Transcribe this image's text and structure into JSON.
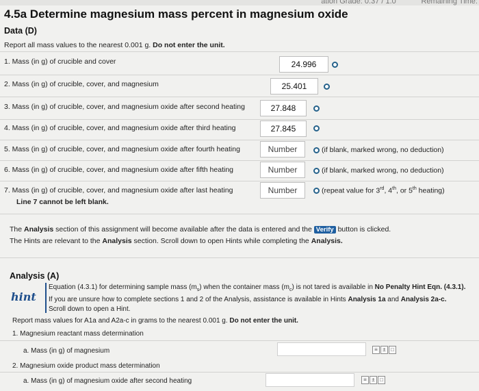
{
  "timer": {
    "label": "Remaining Time:",
    "prefix": "ation Grade: 0.37 / 1.0"
  },
  "title": "4.5a Determine magnesium mass percent in magnesium oxide",
  "data_section": {
    "heading": "Data (D)",
    "instruction_prefix": "Report all mass values to the nearest 0.001 g.",
    "instruction_bold": "Do not enter the unit.",
    "rows": [
      {
        "label": "1. Mass (in g) of crucible and cover",
        "value": "24.996"
      },
      {
        "label": "2. Mass (in g) of crucible, cover, and magnesium",
        "value": "25.401"
      },
      {
        "label": "3. Mass (in g) of crucible, cover, and magnesium oxide after second heating",
        "value": "27.848"
      },
      {
        "label": "4. Mass (in g) of crucible, cover, and magnesium oxide after third heating",
        "value": "27.845"
      },
      {
        "label": "5. Mass (in g) of crucible, cover, and magnesium oxide after fourth heating",
        "placeholder": "Number",
        "note": "(if blank, marked wrong, no deduction)"
      },
      {
        "label": "6. Mass (in g) of crucible, cover, and magnesium oxide after fifth heating",
        "placeholder": "Number",
        "note": "(if blank, marked wrong, no deduction)"
      },
      {
        "label": "7. Mass (in g) of crucible, cover, and magnesium oxide after last heating",
        "placeholder": "Number",
        "note_a": "(repeat value for 3",
        "note_sup1": "rd",
        "note_b": ", 4",
        "note_sup2": "th",
        "note_c": ", or 5",
        "note_sup3": "th",
        "note_d": " heating)"
      }
    ],
    "row7_sub": "Line 7 cannot be left blank."
  },
  "analysis_info": {
    "p1_a": "The",
    "p1_b": "Analysis",
    "p1_c": "section of this assignment will become available after the data is entered and the",
    "verify": "Verify",
    "p1_d": "button is clicked.",
    "p2_a": "The Hints are relevant to the",
    "p2_b": "Analysis",
    "p2_c": "section. Scroll down to open Hints while completing the",
    "p2_d": "Analysis."
  },
  "analysis": {
    "heading": "Analysis (A)",
    "hint_word": "hint",
    "hint_l1_a": "Equation (4.3.1) for determining sample mass (m",
    "hint_l1_sub1": "s",
    "hint_l1_b": ") when the container mass (m",
    "hint_l1_sub2": "c",
    "hint_l1_c": ") is not tared is available in",
    "hint_l1_bold": "No Penalty Hint Eqn. (4.3.1).",
    "hint_l2_a": "If you are unsure how to complete sections 1 and 2 of the Analysis, assistance is available in Hints",
    "hint_l2_b": "Analysis 1a",
    "hint_l2_c": "and",
    "hint_l2_d": "Analysis 2a-c.",
    "hint_l3": "Scroll down to open a Hint.",
    "report_a": "Report mass values for A1a and A2a-c in grams to the nearest 0.001 g.",
    "report_b": "Do not enter the unit.",
    "s1": "1. Magnesium reactant mass determination",
    "s1a": "a. Mass (in g) of magnesium",
    "s2": "2. Magnesium oxide product mass determination",
    "s2a": "a. Mass (in g) of magnesium oxide after second heating"
  }
}
